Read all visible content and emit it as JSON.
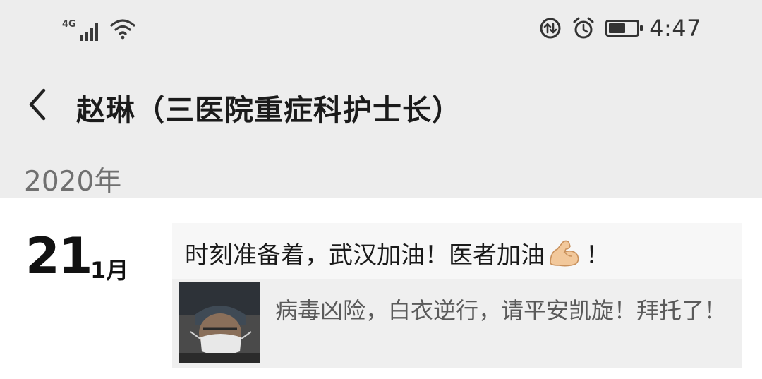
{
  "status_bar": {
    "network": "4G",
    "time": "4:47",
    "battery_level": 0.55,
    "icons": [
      "signal-icon",
      "wifi-icon",
      "data-saver-icon",
      "alarm-icon",
      "battery-icon"
    ]
  },
  "header": {
    "back_icon": "chevron-left-icon",
    "title": "赵琳（三医院重症科护士长）"
  },
  "timeline": {
    "year": "2020年",
    "entries": [
      {
        "day": "21",
        "month": "1月",
        "text_before_emoji": "时刻准备着，武汉加油！医者加油",
        "emoji": "flexed-biceps-icon",
        "text_after_emoji": "！",
        "shared_item": {
          "thumbnail": "masked-doctor-photo",
          "text": "病毒凶险，白衣逆行，请平安凯旋！拜托了！"
        }
      }
    ]
  },
  "colors": {
    "background": "#ededed",
    "card": "#ffffff",
    "post_background": "#f7f7f7",
    "shared_background": "#efefef",
    "year_text": "#707070",
    "shared_text": "#5a5a5a"
  }
}
